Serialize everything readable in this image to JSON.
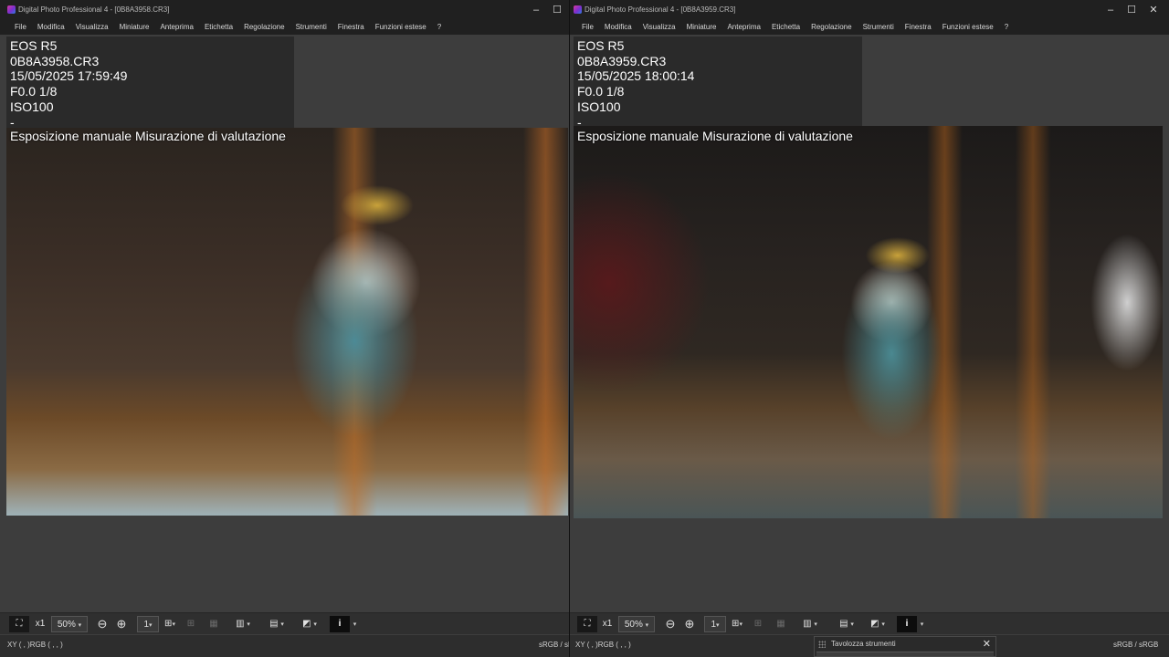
{
  "left_window": {
    "title": "Digital Photo Professional 4 - [0B8A3958.CR3]",
    "info": {
      "camera": "EOS R5",
      "file": "0B8A3958.CR3",
      "datetime": "15/05/2025 17:59:49",
      "exposure": "F0.0 1/8",
      "iso": "ISO100",
      "dash": "-",
      "mode": "Esposizione manuale Misurazione di valutazione"
    },
    "toolbar": {
      "zoom_x1": "x1",
      "zoom": "50%"
    },
    "status": {
      "xy": "XY (     ,     )RGB (   ,   ,   )",
      "colorspace": "sRGB / sR"
    }
  },
  "right_window": {
    "title": "Digital Photo Professional 4 - [0B8A3959.CR3]",
    "info": {
      "camera": "EOS R5",
      "file": "0B8A3959.CR3",
      "datetime": "15/05/2025 18:00:14",
      "exposure": "F0.0 1/8",
      "iso": "ISO100",
      "dash": "-",
      "mode": "Esposizione manuale Misurazione di valutazione"
    },
    "toolbar": {
      "zoom_x1": "x1",
      "zoom": "50%"
    },
    "status": {
      "xy": "XY (     ,     )RGB (   ,   ,   )",
      "colorspace": "sRGB / sRGB"
    }
  },
  "menu": [
    "File",
    "Modifica",
    "Visualizza",
    "Miniature",
    "Anteprima",
    "Etichetta",
    "Regolazione",
    "Strumenti",
    "Finestra",
    "Funzioni estese",
    "?"
  ],
  "window_controls": {
    "minimize": "–",
    "maximize": "☐",
    "close": "✕"
  },
  "toolbar_glyphs": {
    "fit": "⛶",
    "zoom_out": "⊖",
    "zoom_in": "⊕",
    "arrow": "▾",
    "single": "1",
    "compare": "⊞",
    "grid": "⊞",
    "af": "▦",
    "bars": "▥",
    "mesh": "▤",
    "tone": "◩",
    "info": "i"
  },
  "palette": {
    "title": "Tavolozza strumenti",
    "close": "✕"
  },
  "colors": {
    "accent_icon": "#b0399b",
    "chrome": "#202020",
    "panel": "#3d3d3d"
  }
}
